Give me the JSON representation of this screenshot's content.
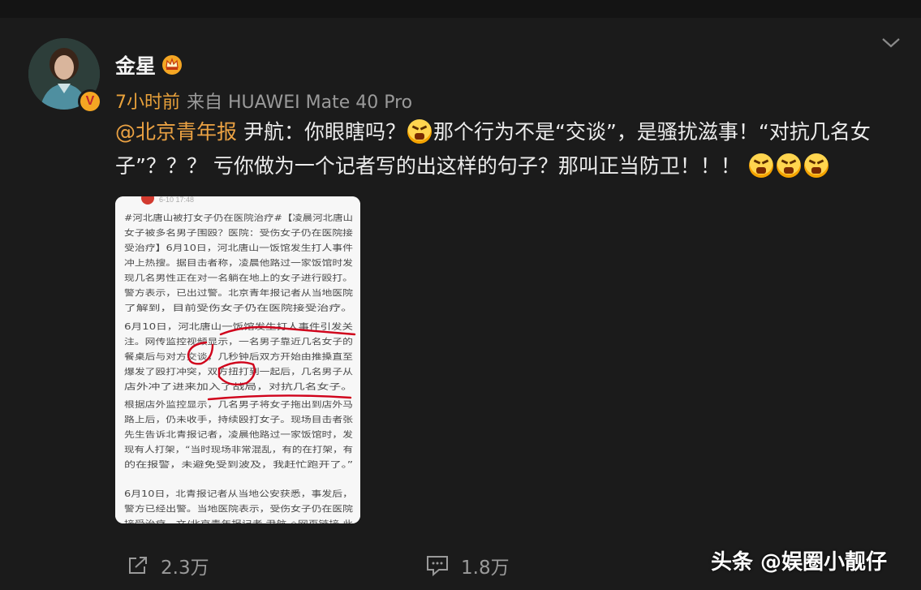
{
  "user": {
    "name": "金星",
    "verified_badge": "V",
    "crown_icon": "crown-icon"
  },
  "meta": {
    "time": "7小时前",
    "source": "来自 HUAWEI Mate 40 Pro"
  },
  "post": {
    "mention": "@北京青年报",
    "text_1": " 尹航：你眼瞎吗？",
    "text_2": "那个行为不是“交谈”，是骚扰滋事！“对抗几名女子”？？？ 亏你做为一个记者写的出这样的句子？那叫正当防卫！！！ ",
    "emoji_name": "angry-face-icon"
  },
  "image_text": {
    "date": "6-10 17:48",
    "para1": [
      "#河北唐山被打女子仍在医院治疗#【凌晨河北唐山",
      "女子被多名男子围殴？医院：受伤女子仍在医院接",
      "受治疗】6月10日，河北唐山一饭馆发生打人事件",
      "冲上热搜。据目击者称，凌晨他路过一家饭馆时发",
      "现几名男性正在对一名躺在地上的女子进行殴打。",
      "警方表示，已出过警。北京青年报记者从当地医院",
      "了解到，目前受伤女子仍在医院接受治疗。"
    ],
    "para2": [
      "6月10日，河北唐山一饭馆发生打人事件引发关",
      "注。网传监控视频显示，一名男子靠近几名女子的",
      "餐桌后与对方交谈，几秒钟后双方开始由推搡直至",
      "爆发了殴打冲突，双方扭打到一起后，几名男子从",
      "店外冲了进来加入了战局，对抗几名女子。"
    ],
    "para3": [
      "根据店外监控显示，几名男子将女子拖出到店外马",
      "路上后，仍未收手，持续殴打女子。现场目击者张",
      "先生告诉北青报记者，凌晨他路过一家饭馆时，发",
      "现有人打架，“当时现场非常混乱，有的在打架，有",
      "的在报警，未避免受到波及，我赶忙跑开了。”"
    ],
    "para4": [
      "6月10日，北青报记者从当地公安获悉，事发后，",
      "警方已经出警。当地医院表示，受伤女子仍在医院",
      "接受治疗。文/北京青年报记者 尹航 ◇网页链接 此"
    ]
  },
  "actions": {
    "share_count": "2.3万",
    "comment_count": "1.8万"
  },
  "watermark": "头条 @娱圈小靓仔",
  "colors": {
    "background": "#1b1b1b",
    "accent": "#eba243",
    "muted": "#9a9a9a",
    "red_ink": "#d0021b"
  }
}
